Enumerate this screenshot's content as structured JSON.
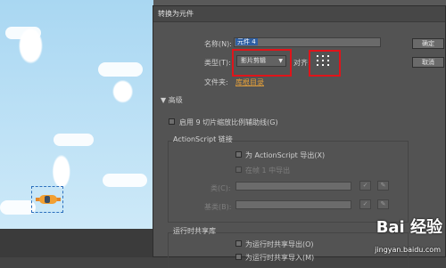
{
  "dialog": {
    "title": "转换为元件",
    "name_label": "名称(N):",
    "name_value": "元件 4",
    "type_label": "类型(T):",
    "type_value": "影片剪辑",
    "align_label": "对齐:",
    "folder_label": "文件夹:",
    "folder_link": "库根目录",
    "advanced_label": "高级",
    "nine_slice_label": "启用 9 切片缩放比例辅助线(G)",
    "actionscript_group": "ActionScript 链接",
    "export_as_label": "为 ActionScript 导出(X)",
    "export_frame1_label": "在帧 1 中导出",
    "class_label": "类(C):",
    "base_class_label": "基类(B):",
    "runtime_group": "运行时共享库",
    "export_runtime_label": "为运行时共享导出(O)",
    "import_runtime_label": "为运行时共享导入(M)",
    "ok_label": "确定",
    "cancel_label": "取消"
  },
  "watermark": {
    "logo": "Bai 经验",
    "url": "jingyan.baidu.com"
  },
  "colors": {
    "highlight_box": "#e0141a",
    "link": "#e8a23a",
    "dialog_bg": "#535353"
  }
}
